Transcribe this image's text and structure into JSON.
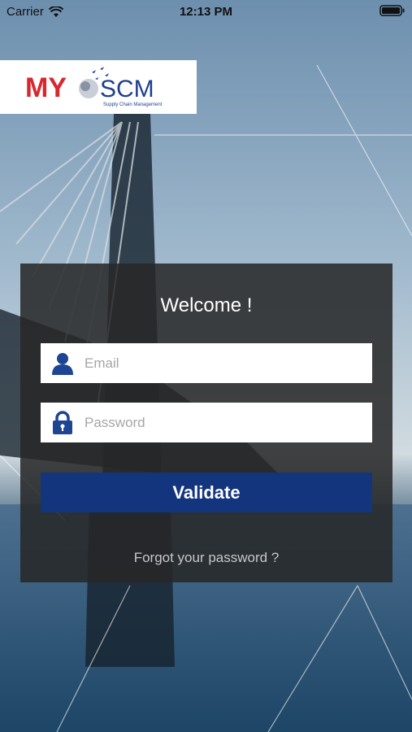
{
  "status_bar": {
    "carrier": "Carrier",
    "time": "12:13 PM",
    "icons": [
      "wifi-icon",
      "battery-icon"
    ]
  },
  "logo": {
    "brand_left": "MY",
    "brand_right": "SCM",
    "tagline": "Supply Chain Management",
    "colors": {
      "red": "#d9272e",
      "blue": "#1e3f8f"
    }
  },
  "login": {
    "title": "Welcome !",
    "email": {
      "value": "",
      "placeholder": "Email",
      "icon": "user-icon"
    },
    "password": {
      "value": "",
      "placeholder": "Password",
      "icon": "lock-icon"
    },
    "validate_label": "Validate",
    "forgot_label": "Forgot your password ?"
  },
  "colors": {
    "button": "#12357e",
    "icon": "#1d4593",
    "card": "#262626"
  }
}
